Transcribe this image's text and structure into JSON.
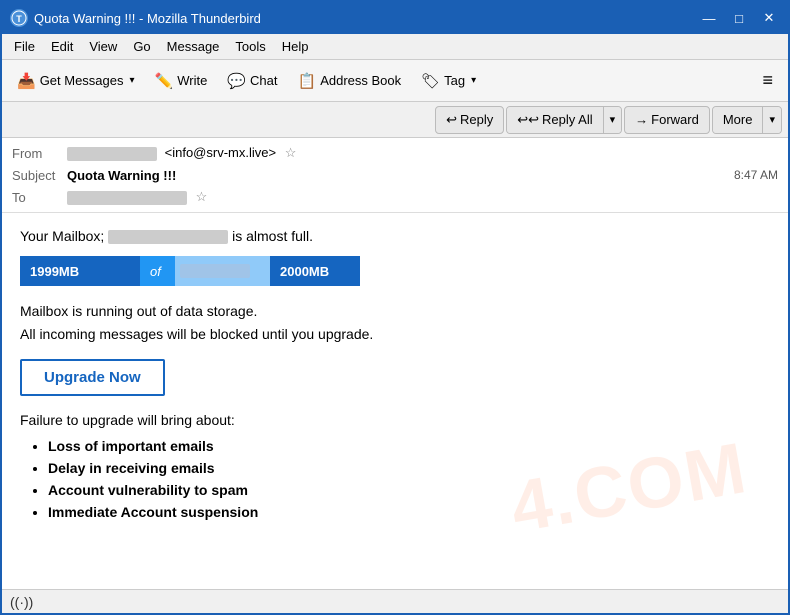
{
  "window": {
    "title": "Quota Warning !!! - Mozilla Thunderbird",
    "icon": "T"
  },
  "menu": {
    "items": [
      "File",
      "Edit",
      "View",
      "Go",
      "Message",
      "Tools",
      "Help"
    ]
  },
  "toolbar": {
    "get_messages_label": "Get Messages",
    "write_label": "Write",
    "chat_label": "Chat",
    "address_book_label": "Address Book",
    "tag_label": "Tag",
    "hamburger_label": "≡"
  },
  "action_bar": {
    "reply_label": "Reply",
    "reply_all_label": "Reply All",
    "forward_label": "Forward",
    "more_label": "More"
  },
  "email": {
    "from_label": "From",
    "from_blurred": "",
    "from_address": "<info@srv-mx.live>",
    "subject_label": "Subject",
    "subject_value": "Quota Warning !!!",
    "to_label": "To",
    "to_blurred": "",
    "timestamp": "8:47 AM"
  },
  "body": {
    "intro_text": "Your Mailbox;",
    "intro_blurred": "",
    "intro_end": "is almost full.",
    "quota_used": "1999MB",
    "quota_of": "of",
    "quota_max": "2000MB",
    "warning_line1": "Mailbox is running out of data storage.",
    "warning_line2": "All incoming messages will be blocked until you upgrade.",
    "upgrade_btn": "Upgrade Now",
    "failure_intro": "Failure to upgrade will bring about:",
    "bullets": [
      "Loss of important emails",
      "Delay in receiving emails",
      "Account vulnerability to spam",
      "Immediate Account suspension"
    ]
  },
  "status_bar": {
    "icon": "((·))",
    "text": ""
  }
}
